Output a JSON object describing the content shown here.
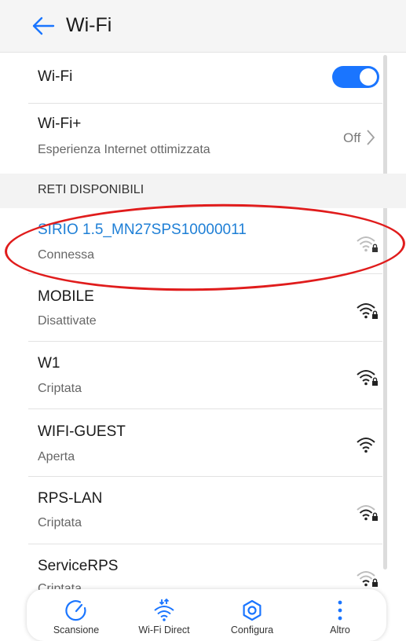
{
  "header": {
    "title": "Wi-Fi"
  },
  "wifi_toggle": {
    "label": "Wi-Fi",
    "state": "on"
  },
  "wifi_plus": {
    "title": "Wi-Fi+",
    "subtitle": "Esperienza Internet ottimizzata",
    "value": "Off"
  },
  "section": {
    "label": "RETI DISPONIBILI"
  },
  "networks": [
    {
      "name": "SIRIO 1.5_MN27SPS10000011",
      "status": "Connessa"
    },
    {
      "name": "MOBILE",
      "status": "Disattivate"
    },
    {
      "name": "W1",
      "status": "Criptata"
    },
    {
      "name": "WIFI-GUEST",
      "status": "Aperta"
    },
    {
      "name": "RPS-LAN",
      "status": "Criptata"
    },
    {
      "name": "ServiceRPS",
      "status": "Criptata"
    }
  ],
  "bottom_nav": [
    {
      "label": "Scansione",
      "icon": "scan-icon"
    },
    {
      "label": "Wi-Fi Direct",
      "icon": "wifi-direct-icon"
    },
    {
      "label": "Configura",
      "icon": "gear-icon"
    },
    {
      "label": "Altro",
      "icon": "more-icon"
    }
  ],
  "colors": {
    "accent": "#1a75ff",
    "connected_text": "#1e7fd6",
    "annotation": "#e01c1c"
  }
}
